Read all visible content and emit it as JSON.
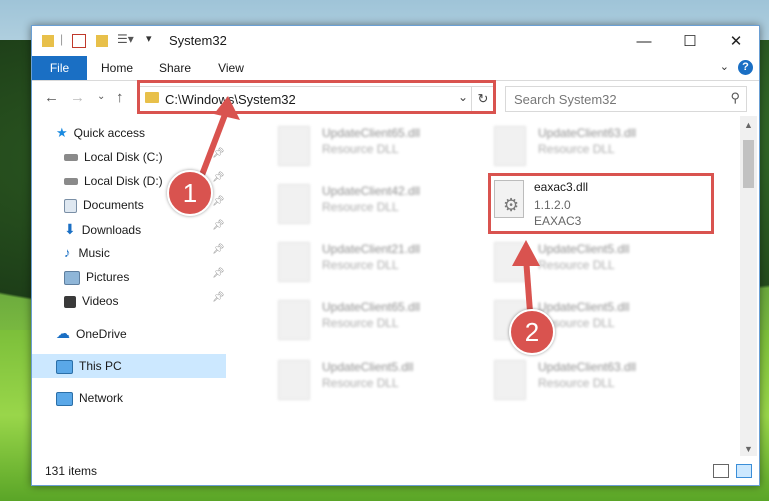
{
  "window": {
    "title": "System32",
    "controls": {
      "minimize": "—",
      "maximize": "☐",
      "close": "✕"
    }
  },
  "ribbon": {
    "tabs": [
      "File",
      "Home",
      "Share",
      "View"
    ],
    "help": "?"
  },
  "nav": {
    "path": "C:\\Windows\\System32",
    "search_placeholder": "Search System32"
  },
  "sidebar": {
    "items": [
      {
        "label": "Quick access",
        "icon": "star-icon",
        "pinned": false
      },
      {
        "label": "Local Disk (C:)",
        "icon": "drive-icon",
        "pinned": true
      },
      {
        "label": "Local Disk (D:)",
        "icon": "drive-icon",
        "pinned": true
      },
      {
        "label": "Documents",
        "icon": "documents-icon",
        "pinned": true
      },
      {
        "label": "Downloads",
        "icon": "download-icon",
        "pinned": true
      },
      {
        "label": "Music",
        "icon": "music-icon",
        "pinned": true
      },
      {
        "label": "Pictures",
        "icon": "pictures-icon",
        "pinned": true
      },
      {
        "label": "Videos",
        "icon": "videos-icon",
        "pinned": true
      },
      {
        "label": "OneDrive",
        "icon": "cloud-icon",
        "pinned": false
      },
      {
        "label": "This PC",
        "icon": "computer-icon",
        "pinned": false
      },
      {
        "label": "Network",
        "icon": "network-icon",
        "pinned": false
      }
    ]
  },
  "files": [
    {
      "name": "UpdateClient65.dll",
      "desc": "Resource DLL"
    },
    {
      "name": "UpdateClient63.dll",
      "desc": "Resource DLL"
    },
    {
      "name": "UpdateClient42.dll",
      "desc": "Resource DLL"
    },
    {
      "name": "UpdateClient21.dll",
      "desc": "Resource DLL"
    },
    {
      "name": "UpdateClient5.dll",
      "desc": "Resource DLL"
    },
    {
      "name": "UpdateClient65.dll",
      "desc": "Resource DLL"
    },
    {
      "name": "UpdateClient5.dll",
      "desc": "Resource DLL"
    },
    {
      "name": "UpdateClient5.dll",
      "desc": "Resource DLL"
    },
    {
      "name": "UpdateClient63.dll",
      "desc": "Resource DLL"
    }
  ],
  "highlighted_file": {
    "name": "eaxac3.dll",
    "version": "1.1.2.0",
    "desc": "EAXAC3"
  },
  "status": {
    "items": "131 items"
  },
  "callouts": {
    "one": "1",
    "two": "2"
  },
  "colors": {
    "accent": "#1a6fc4",
    "highlight": "#d9534f",
    "selection": "#cce8ff"
  }
}
